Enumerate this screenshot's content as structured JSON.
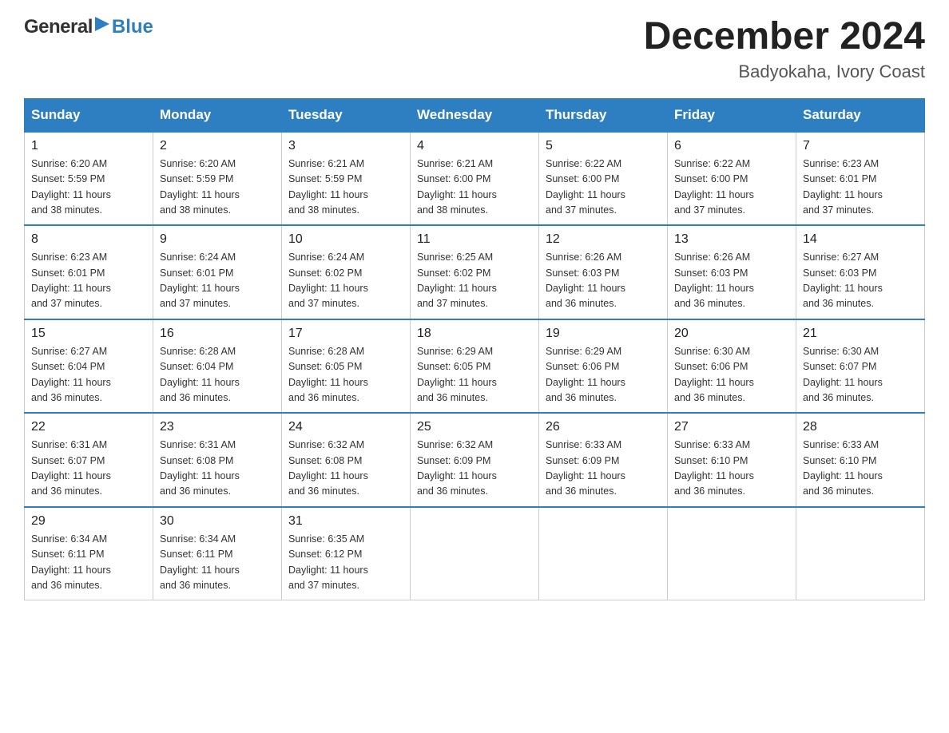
{
  "header": {
    "logo": {
      "text_general": "General",
      "text_blue": "Blue",
      "arrow_label": "general-blue-logo-arrow"
    },
    "title": "December 2024",
    "location": "Badyokaha, Ivory Coast"
  },
  "days_of_week": [
    "Sunday",
    "Monday",
    "Tuesday",
    "Wednesday",
    "Thursday",
    "Friday",
    "Saturday"
  ],
  "weeks": [
    [
      {
        "day": "1",
        "sunrise": "6:20 AM",
        "sunset": "5:59 PM",
        "daylight": "11 hours and 38 minutes."
      },
      {
        "day": "2",
        "sunrise": "6:20 AM",
        "sunset": "5:59 PM",
        "daylight": "11 hours and 38 minutes."
      },
      {
        "day": "3",
        "sunrise": "6:21 AM",
        "sunset": "5:59 PM",
        "daylight": "11 hours and 38 minutes."
      },
      {
        "day": "4",
        "sunrise": "6:21 AM",
        "sunset": "6:00 PM",
        "daylight": "11 hours and 38 minutes."
      },
      {
        "day": "5",
        "sunrise": "6:22 AM",
        "sunset": "6:00 PM",
        "daylight": "11 hours and 37 minutes."
      },
      {
        "day": "6",
        "sunrise": "6:22 AM",
        "sunset": "6:00 PM",
        "daylight": "11 hours and 37 minutes."
      },
      {
        "day": "7",
        "sunrise": "6:23 AM",
        "sunset": "6:01 PM",
        "daylight": "11 hours and 37 minutes."
      }
    ],
    [
      {
        "day": "8",
        "sunrise": "6:23 AM",
        "sunset": "6:01 PM",
        "daylight": "11 hours and 37 minutes."
      },
      {
        "day": "9",
        "sunrise": "6:24 AM",
        "sunset": "6:01 PM",
        "daylight": "11 hours and 37 minutes."
      },
      {
        "day": "10",
        "sunrise": "6:24 AM",
        "sunset": "6:02 PM",
        "daylight": "11 hours and 37 minutes."
      },
      {
        "day": "11",
        "sunrise": "6:25 AM",
        "sunset": "6:02 PM",
        "daylight": "11 hours and 37 minutes."
      },
      {
        "day": "12",
        "sunrise": "6:26 AM",
        "sunset": "6:03 PM",
        "daylight": "11 hours and 36 minutes."
      },
      {
        "day": "13",
        "sunrise": "6:26 AM",
        "sunset": "6:03 PM",
        "daylight": "11 hours and 36 minutes."
      },
      {
        "day": "14",
        "sunrise": "6:27 AM",
        "sunset": "6:03 PM",
        "daylight": "11 hours and 36 minutes."
      }
    ],
    [
      {
        "day": "15",
        "sunrise": "6:27 AM",
        "sunset": "6:04 PM",
        "daylight": "11 hours and 36 minutes."
      },
      {
        "day": "16",
        "sunrise": "6:28 AM",
        "sunset": "6:04 PM",
        "daylight": "11 hours and 36 minutes."
      },
      {
        "day": "17",
        "sunrise": "6:28 AM",
        "sunset": "6:05 PM",
        "daylight": "11 hours and 36 minutes."
      },
      {
        "day": "18",
        "sunrise": "6:29 AM",
        "sunset": "6:05 PM",
        "daylight": "11 hours and 36 minutes."
      },
      {
        "day": "19",
        "sunrise": "6:29 AM",
        "sunset": "6:06 PM",
        "daylight": "11 hours and 36 minutes."
      },
      {
        "day": "20",
        "sunrise": "6:30 AM",
        "sunset": "6:06 PM",
        "daylight": "11 hours and 36 minutes."
      },
      {
        "day": "21",
        "sunrise": "6:30 AM",
        "sunset": "6:07 PM",
        "daylight": "11 hours and 36 minutes."
      }
    ],
    [
      {
        "day": "22",
        "sunrise": "6:31 AM",
        "sunset": "6:07 PM",
        "daylight": "11 hours and 36 minutes."
      },
      {
        "day": "23",
        "sunrise": "6:31 AM",
        "sunset": "6:08 PM",
        "daylight": "11 hours and 36 minutes."
      },
      {
        "day": "24",
        "sunrise": "6:32 AM",
        "sunset": "6:08 PM",
        "daylight": "11 hours and 36 minutes."
      },
      {
        "day": "25",
        "sunrise": "6:32 AM",
        "sunset": "6:09 PM",
        "daylight": "11 hours and 36 minutes."
      },
      {
        "day": "26",
        "sunrise": "6:33 AM",
        "sunset": "6:09 PM",
        "daylight": "11 hours and 36 minutes."
      },
      {
        "day": "27",
        "sunrise": "6:33 AM",
        "sunset": "6:10 PM",
        "daylight": "11 hours and 36 minutes."
      },
      {
        "day": "28",
        "sunrise": "6:33 AM",
        "sunset": "6:10 PM",
        "daylight": "11 hours and 36 minutes."
      }
    ],
    [
      {
        "day": "29",
        "sunrise": "6:34 AM",
        "sunset": "6:11 PM",
        "daylight": "11 hours and 36 minutes."
      },
      {
        "day": "30",
        "sunrise": "6:34 AM",
        "sunset": "6:11 PM",
        "daylight": "11 hours and 36 minutes."
      },
      {
        "day": "31",
        "sunrise": "6:35 AM",
        "sunset": "6:12 PM",
        "daylight": "11 hours and 37 minutes."
      },
      null,
      null,
      null,
      null
    ]
  ],
  "labels": {
    "sunrise": "Sunrise:",
    "sunset": "Sunset:",
    "daylight": "Daylight:"
  }
}
